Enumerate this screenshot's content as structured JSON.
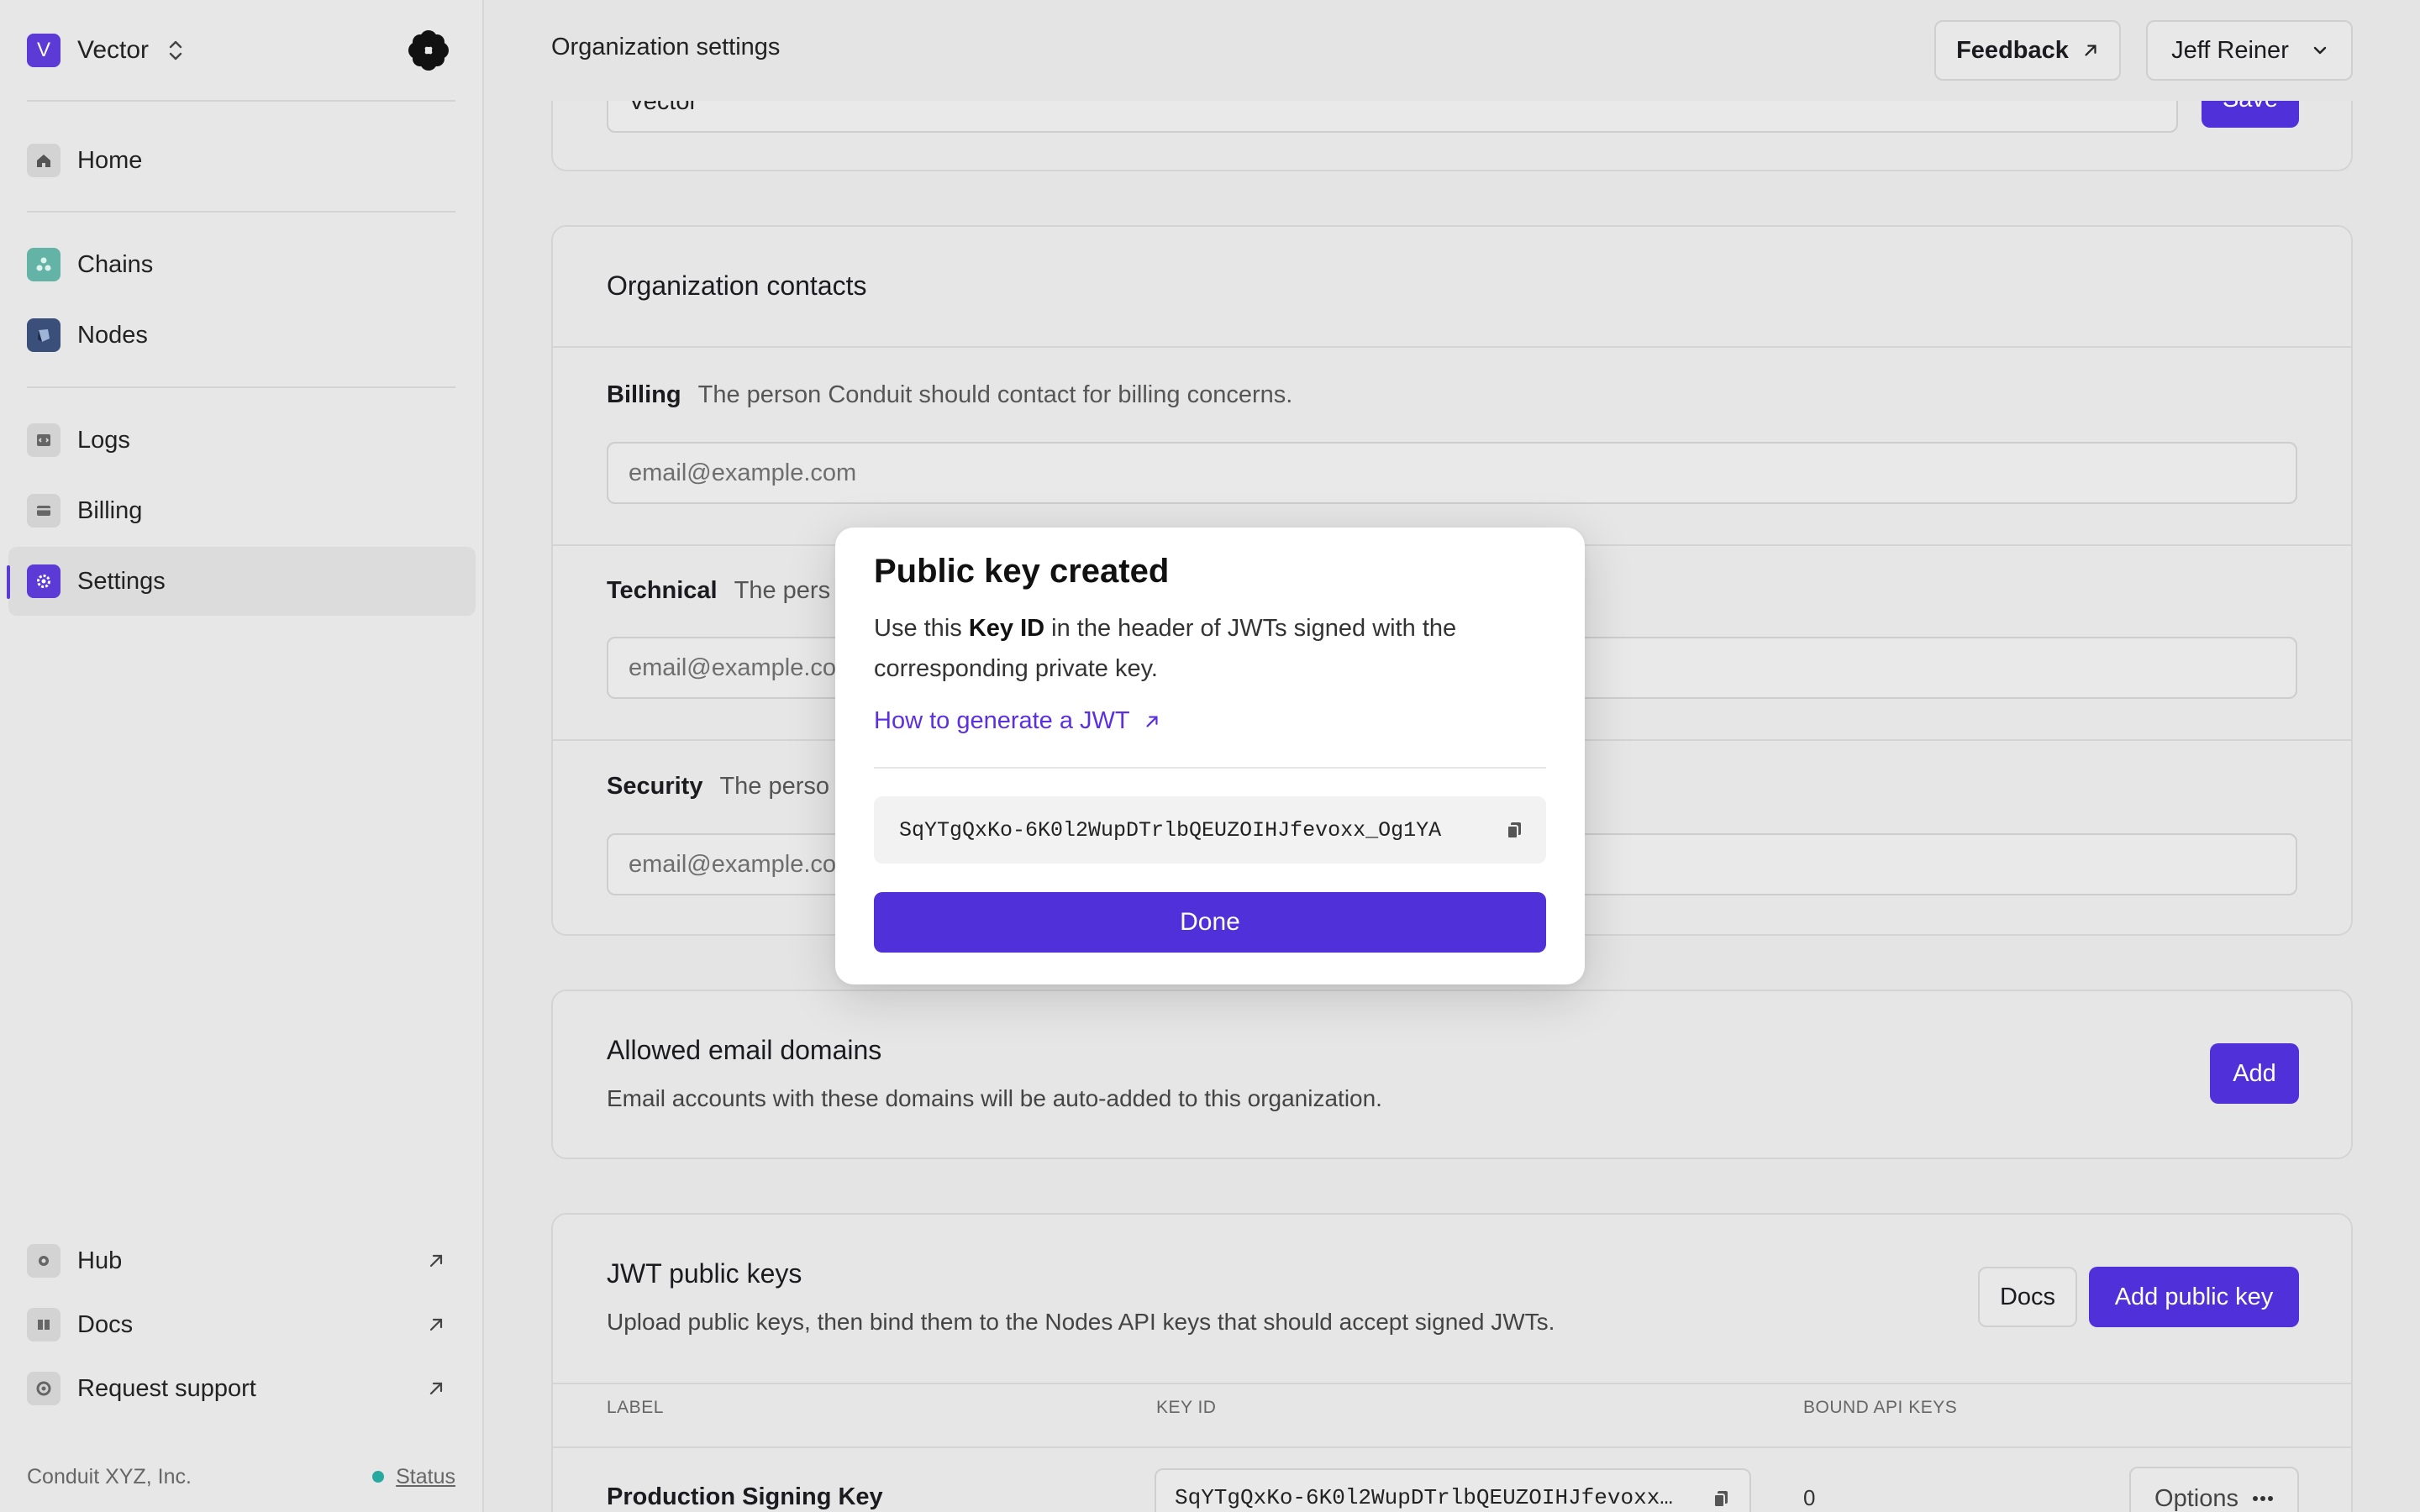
{
  "org": {
    "badge": "V",
    "name": "Vector"
  },
  "sidebar": {
    "items": [
      {
        "label": "Home"
      },
      {
        "label": "Chains"
      },
      {
        "label": "Nodes"
      },
      {
        "label": "Logs"
      },
      {
        "label": "Billing"
      },
      {
        "label": "Settings",
        "active": true
      },
      {
        "label": "Hub"
      },
      {
        "label": "Docs"
      },
      {
        "label": "Request support"
      }
    ],
    "footer": {
      "company": "Conduit XYZ, Inc.",
      "status_label": "Status"
    }
  },
  "header": {
    "title": "Organization settings",
    "feedback_label": "Feedback",
    "user_name": "Jeff Reiner"
  },
  "org_name_card": {
    "value": "Vector",
    "save_label": "Save"
  },
  "contacts": {
    "title": "Organization contacts",
    "rows": [
      {
        "label": "Billing",
        "desc": "The person Conduit should contact for billing concerns.",
        "placeholder": "email@example.com"
      },
      {
        "label": "Technical",
        "desc": "The pers",
        "placeholder": "email@example.com"
      },
      {
        "label": "Security",
        "desc": "The perso",
        "placeholder": "email@example.com"
      }
    ]
  },
  "domains": {
    "title": "Allowed email domains",
    "desc": "Email accounts with these domains will be auto-added to this organization.",
    "add_label": "Add"
  },
  "jwt": {
    "title": "JWT public keys",
    "desc": "Upload public keys, then bind them to the Nodes API keys that should accept signed JWTs.",
    "docs_label": "Docs",
    "add_label": "Add public key",
    "columns": [
      "LABEL",
      "KEY ID",
      "BOUND API KEYS"
    ],
    "rows": [
      {
        "label": "Production Signing Key",
        "key_id": "SqYTgQxKo-6K0l2WupDTrlbQEUZOIHJfevoxx…",
        "bound": "0",
        "options": "Options"
      }
    ]
  },
  "modal": {
    "title": "Public key created",
    "body_prefix": "Use this ",
    "body_bold": "Key ID",
    "body_suffix": " in the header of JWTs signed with the corresponding private key.",
    "link_label": "How to generate a JWT",
    "key_id": "SqYTgQxKo-6K0l2WupDTrlbQEUZOIHJfevoxx_Og1YA",
    "done_label": "Done"
  },
  "colors": {
    "accent": "#5030d8",
    "status": "#27a9a0"
  },
  "icons": [
    "updown-chevron-icon",
    "flower-logo-icon",
    "home-icon",
    "chains-icon",
    "nodes-icon",
    "logs-icon",
    "billing-icon",
    "settings-icon",
    "hub-icon",
    "docs-icon",
    "support-icon",
    "external-arrow-icon",
    "chevron-down-icon",
    "copy-icon",
    "more-icon"
  ]
}
